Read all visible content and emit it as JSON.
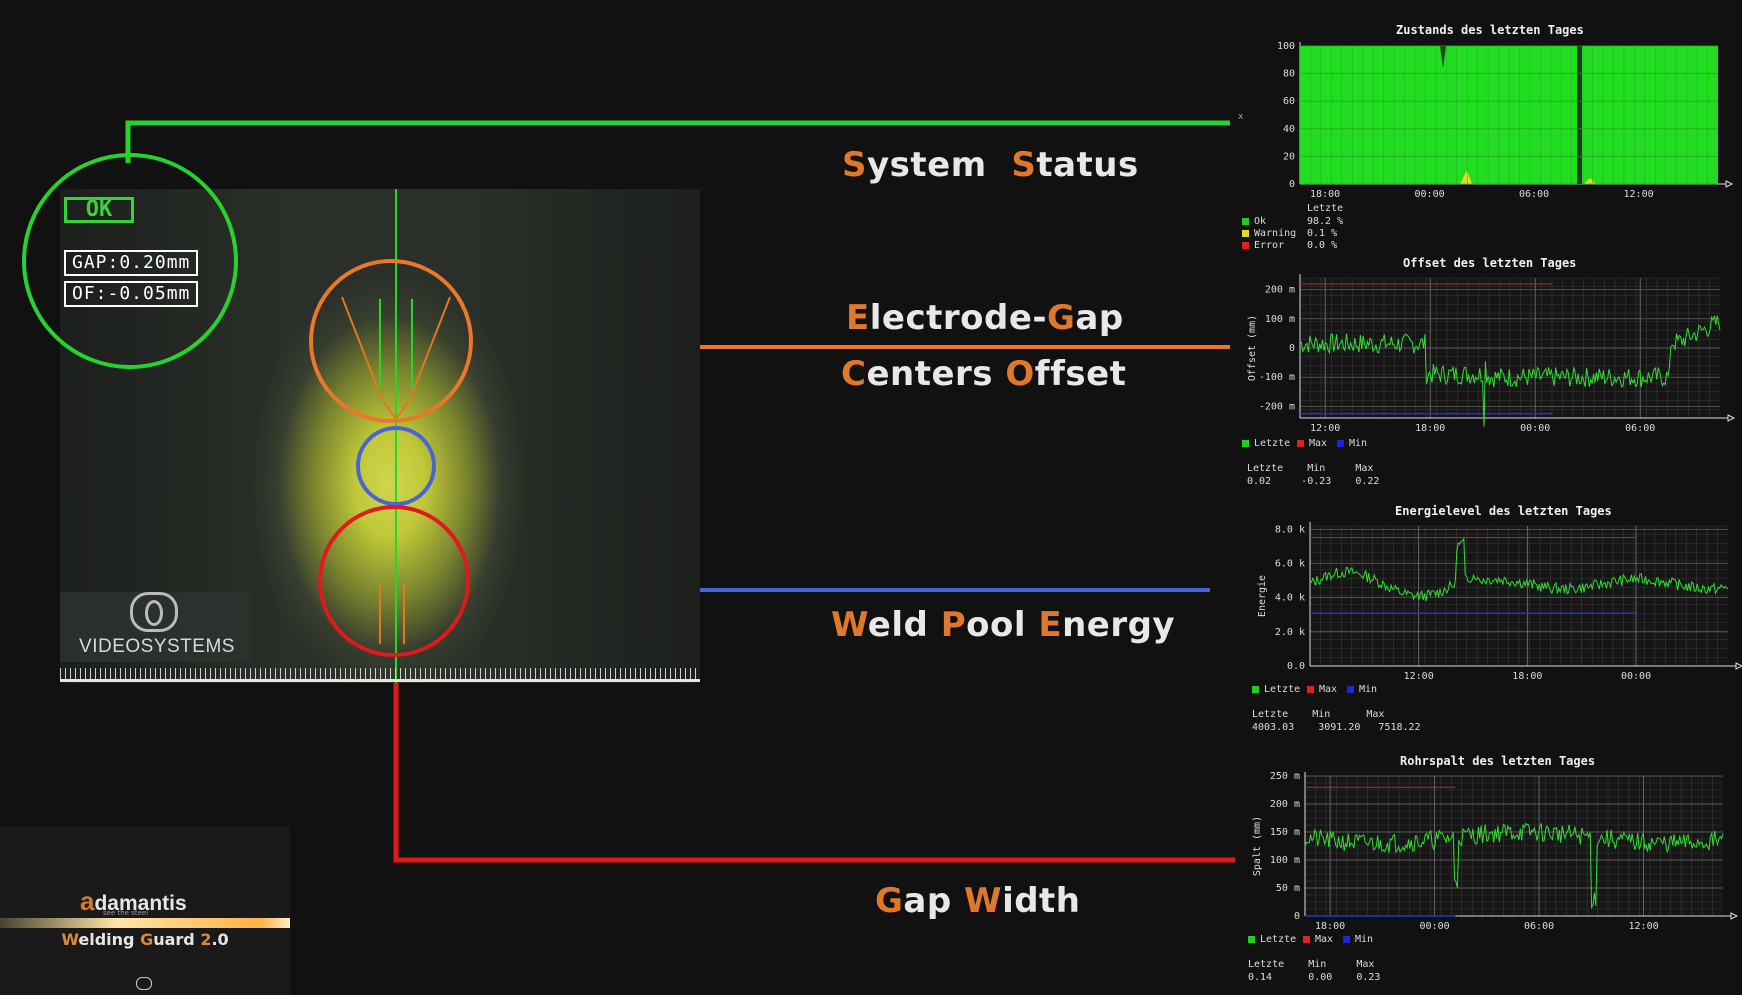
{
  "camera": {
    "status_badge": "OK",
    "gap_readout": "GAP:0.20mm",
    "offset_readout": "OF:-0.05mm",
    "logo_text": "VIDEOSYSTEMS"
  },
  "labels": {
    "system_status": {
      "c1": "S",
      "r1": "ystem ",
      "c2": "S",
      "r2": "tatus"
    },
    "electrode_gap": {
      "c1": "E",
      "r1": "lectrode-",
      "c2": "G",
      "r2": "ap"
    },
    "centers_offset": {
      "c1": "C",
      "r1": "enters ",
      "c2": "O",
      "r2": "ffset"
    },
    "weld_pool_energy": {
      "c1": "W",
      "r1": "eld ",
      "c2": "P",
      "r2": "ool ",
      "c3": "E",
      "r3": "nergy"
    },
    "gap_width": {
      "c1": "G",
      "r1": "ap ",
      "c2": "W",
      "r2": "idth"
    }
  },
  "brand": {
    "name_first": "a",
    "name_rest": "damantis",
    "tagline": "see the steel",
    "product_w": "W",
    "product_w_rest": "elding ",
    "product_g": "G",
    "product_g_rest": "uard ",
    "product_2": "2",
    "product_ver": ".0"
  },
  "colors": {
    "status_line": "#28d12c",
    "offset_line": "#e9782b",
    "energy_line": "#4a63d6",
    "gap_line": "#e0191b",
    "accent": "#e0782a"
  },
  "chart_data": [
    {
      "type": "area",
      "title": "Zustands des letzten Tages",
      "ylabel": "",
      "yticks": [
        "0",
        "20",
        "40",
        "60",
        "80",
        "100"
      ],
      "xticks": [
        "18:00",
        "00:00",
        "06:00",
        "12:00"
      ],
      "ylim": [
        0,
        100
      ],
      "series": [
        {
          "name": "Ok",
          "values": [
            100,
            100,
            100,
            100,
            100,
            100,
            100,
            100,
            100,
            100,
            100,
            100,
            100,
            100,
            100,
            100,
            100,
            100,
            100,
            100,
            100,
            100,
            100,
            100,
            100,
            100,
            100,
            100,
            100,
            100,
            100,
            100,
            100,
            100,
            100,
            100,
            100,
            100,
            100,
            100,
            100,
            100,
            100,
            100,
            100,
            100,
            100,
            100,
            100,
            100,
            100,
            100,
            100,
            100,
            100,
            100,
            100,
            100,
            100,
            100,
            100,
            100,
            100,
            100,
            100,
            100,
            100,
            100,
            100,
            100,
            100,
            100,
            100,
            100,
            100,
            100,
            100,
            100,
            100,
            100,
            100,
            100,
            100,
            100,
            100,
            100,
            100,
            100,
            100,
            100,
            100,
            100,
            100,
            100,
            100,
            100,
            100,
            100,
            100,
            100,
            100,
            100,
            100,
            100,
            100,
            100,
            100,
            100,
            100,
            100,
            100,
            100,
            100,
            100,
            100,
            100,
            100,
            100,
            100,
            100,
            100,
            100,
            100,
            100,
            100,
            100,
            100,
            100,
            100,
            100,
            100,
            100,
            100,
            100,
            100,
            100,
            100,
            100,
            100,
            100,
            100,
            100,
            100,
            100,
            100,
            100,
            100,
            100,
            100,
            100,
            100,
            100,
            100,
            100,
            100,
            100,
            100,
            100,
            100,
            100,
            100,
            100,
            100,
            100
          ]
        }
      ],
      "legend_header": "Letzte",
      "legend": [
        {
          "name": "Ok",
          "color": "#22cc22",
          "value": "98.2 %"
        },
        {
          "name": "Warning",
          "color": "#dddd22",
          "value": "0.1 %"
        },
        {
          "name": "Error",
          "color": "#dd2222",
          "value": "0.0 %"
        }
      ]
    },
    {
      "type": "line",
      "title": "Offset des letzten Tages",
      "ylabel": "Offset (mm)",
      "yticks": [
        "-200 m",
        "-100 m",
        "0",
        "100 m",
        "200 m"
      ],
      "xticks": [
        "12:00",
        "18:00",
        "00:00",
        "06:00"
      ],
      "ylim": [
        -240,
        240
      ],
      "max": 0.22,
      "min": -0.23,
      "last": 0.02,
      "legend": [
        {
          "name": "Letzte",
          "color": "#22cc22"
        },
        {
          "name": "Max",
          "color": "#dd2222"
        },
        {
          "name": "Min",
          "color": "#2222dd"
        }
      ],
      "stats_header": "Letzte    Min     Max",
      "stats_values": "0.02     -0.23    0.22"
    },
    {
      "type": "line",
      "title": "Energielevel des letzten Tages",
      "ylabel": "Energie",
      "yticks": [
        "0.0",
        "2.0 k",
        "4.0 k",
        "6.0 k",
        "8.0 k"
      ],
      "xticks": [
        "12:00",
        "18:00",
        "00:00"
      ],
      "ylim": [
        0,
        8200
      ],
      "max": 7518.22,
      "min": 3091.2,
      "last": 4003.03,
      "legend": [
        {
          "name": "Letzte",
          "color": "#22cc22"
        },
        {
          "name": "Max",
          "color": "#dd2222"
        },
        {
          "name": "Min",
          "color": "#2222dd"
        }
      ],
      "stats_header": "Letzte    Min      Max",
      "stats_values": "4003.03    3091.20   7518.22"
    },
    {
      "type": "line",
      "title": "Rohrspalt des letzten Tages",
      "ylabel": "Spalt (mm)",
      "yticks": [
        "0",
        "50 m",
        "100 m",
        "150 m",
        "200 m",
        "250 m"
      ],
      "xticks": [
        "18:00",
        "00:00",
        "06:00",
        "12:00"
      ],
      "ylim": [
        0,
        250
      ],
      "max": 0.23,
      "min": 0.0,
      "last": 0.14,
      "legend": [
        {
          "name": "Letzte",
          "color": "#22cc22"
        },
        {
          "name": "Max",
          "color": "#dd2222"
        },
        {
          "name": "Min",
          "color": "#2222dd"
        }
      ],
      "stats_header": "Letzte    Min     Max",
      "stats_values": "0.14      0.00    0.23"
    }
  ]
}
